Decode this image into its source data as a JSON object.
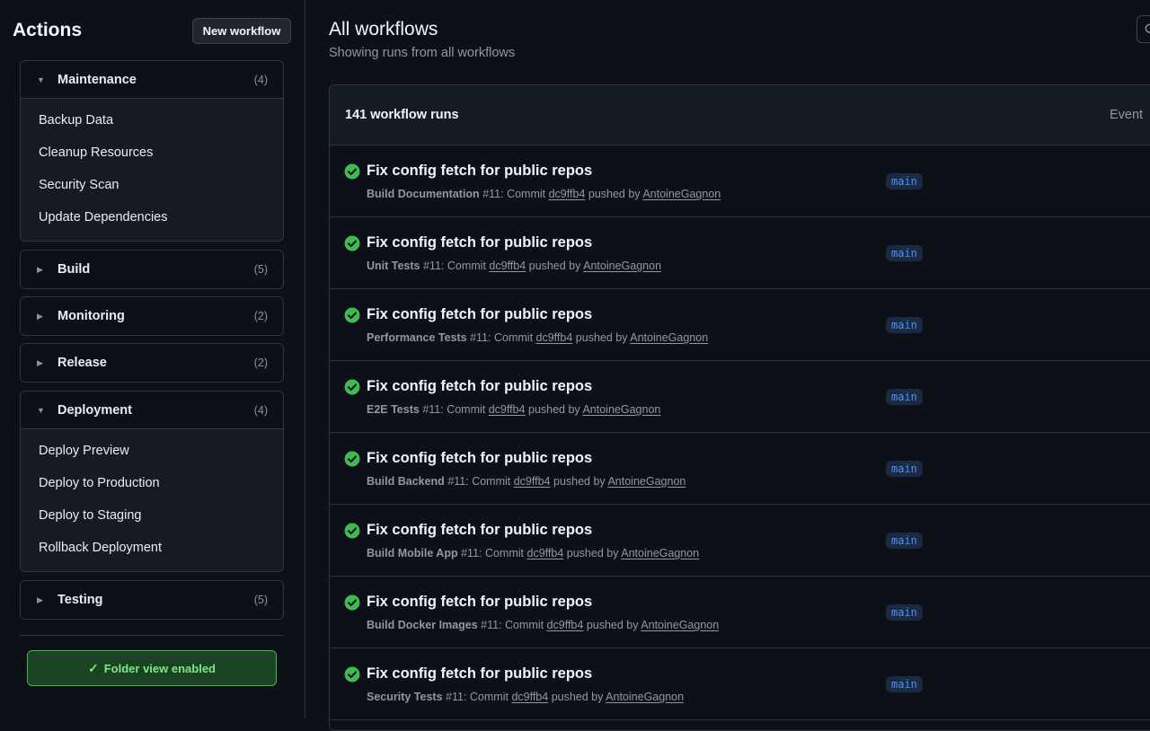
{
  "sidebar": {
    "title": "Actions",
    "new_workflow_label": "New workflow",
    "folders": [
      {
        "name": "Maintenance",
        "count": "(4)",
        "expanded": true,
        "items": [
          "Backup Data",
          "Cleanup Resources",
          "Security Scan",
          "Update Dependencies"
        ]
      },
      {
        "name": "Build",
        "count": "(5)",
        "expanded": false,
        "items": []
      },
      {
        "name": "Monitoring",
        "count": "(2)",
        "expanded": false,
        "items": []
      },
      {
        "name": "Release",
        "count": "(2)",
        "expanded": false,
        "items": []
      },
      {
        "name": "Deployment",
        "count": "(4)",
        "expanded": true,
        "items": [
          "Deploy Preview",
          "Deploy to Production",
          "Deploy to Staging",
          "Rollback Deployment"
        ]
      },
      {
        "name": "Testing",
        "count": "(5)",
        "expanded": false,
        "items": []
      }
    ],
    "folder_view_label": "Folder view enabled"
  },
  "main": {
    "title": "All workflows",
    "subtitle": "Showing runs from all workflows",
    "runs_count": "141 workflow runs",
    "event_filter_label": "Event",
    "runs": [
      {
        "title": "Fix config fetch for public repos",
        "workflow": "Build Documentation",
        "run_number": "#11",
        "commit": "dc9ffb4",
        "author": "AntoineGagnon",
        "branch": "main",
        "status": "success"
      },
      {
        "title": "Fix config fetch for public repos",
        "workflow": "Unit Tests",
        "run_number": "#11",
        "commit": "dc9ffb4",
        "author": "AntoineGagnon",
        "branch": "main",
        "status": "success"
      },
      {
        "title": "Fix config fetch for public repos",
        "workflow": "Performance Tests",
        "run_number": "#11",
        "commit": "dc9ffb4",
        "author": "AntoineGagnon",
        "branch": "main",
        "status": "success"
      },
      {
        "title": "Fix config fetch for public repos",
        "workflow": "E2E Tests",
        "run_number": "#11",
        "commit": "dc9ffb4",
        "author": "AntoineGagnon",
        "branch": "main",
        "status": "success"
      },
      {
        "title": "Fix config fetch for public repos",
        "workflow": "Build Backend",
        "run_number": "#11",
        "commit": "dc9ffb4",
        "author": "AntoineGagnon",
        "branch": "main",
        "status": "success"
      },
      {
        "title": "Fix config fetch for public repos",
        "workflow": "Build Mobile App",
        "run_number": "#11",
        "commit": "dc9ffb4",
        "author": "AntoineGagnon",
        "branch": "main",
        "status": "success"
      },
      {
        "title": "Fix config fetch for public repos",
        "workflow": "Build Docker Images",
        "run_number": "#11",
        "commit": "dc9ffb4",
        "author": "AntoineGagnon",
        "branch": "main",
        "status": "success"
      },
      {
        "title": "Fix config fetch for public repos",
        "workflow": "Security Tests",
        "run_number": "#11",
        "commit": "dc9ffb4",
        "author": "AntoineGagnon",
        "branch": "main",
        "status": "success"
      }
    ]
  },
  "text": {
    "commit_word": ": Commit ",
    "pushed_by": " pushed by "
  },
  "colors": {
    "background": "#0d1117",
    "success": "#3fb950",
    "branch_text": "#4493f8",
    "border": "#30363d"
  },
  "icons": {
    "expanded_caret": "▼",
    "collapsed_caret": "▶",
    "check": "✓"
  }
}
